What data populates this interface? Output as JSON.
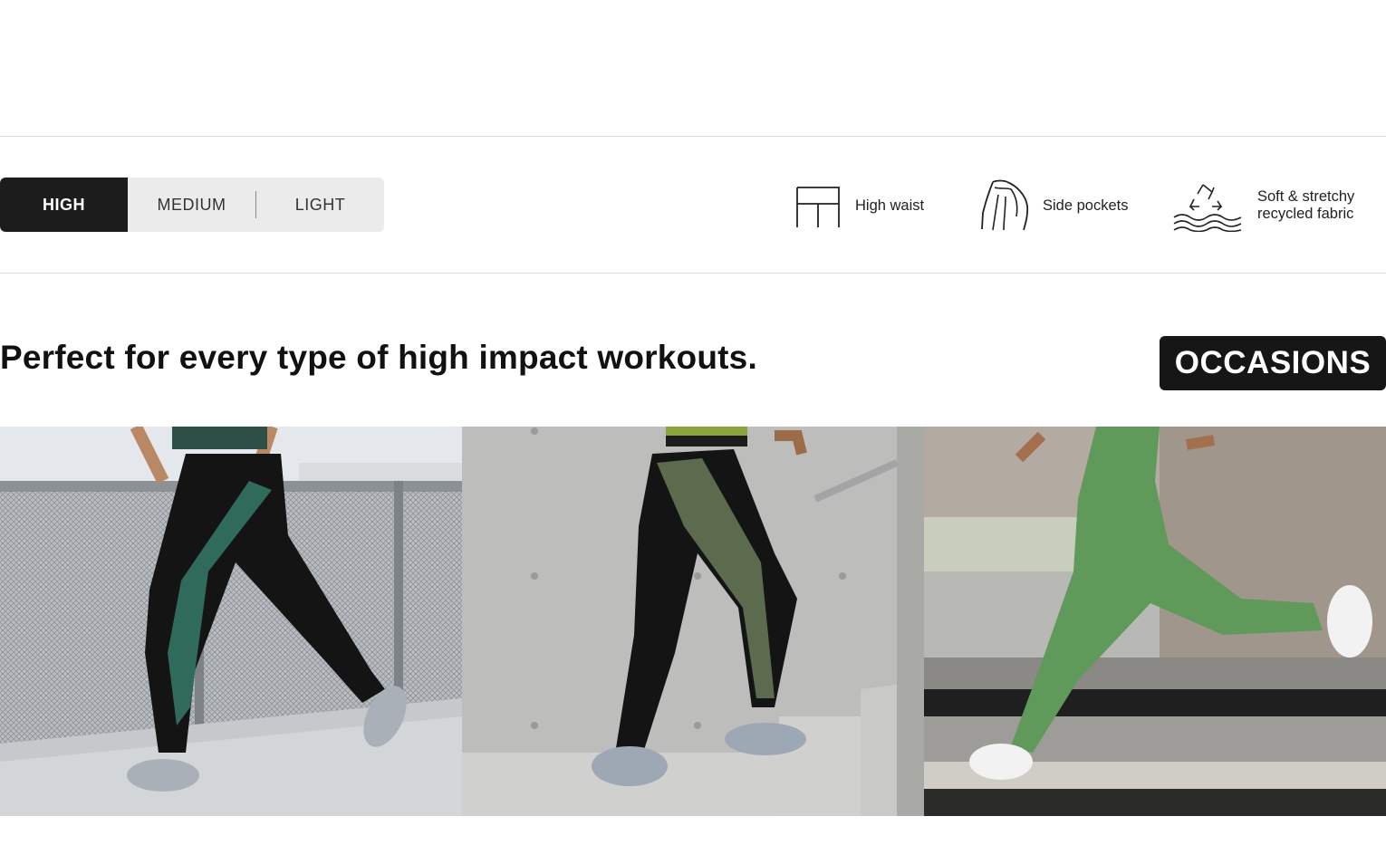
{
  "impact_selector": {
    "options": [
      "HIGH",
      "MEDIUM",
      "LIGHT"
    ],
    "selected": "HIGH"
  },
  "features": [
    {
      "icon": "high-waist-icon",
      "label": "High waist"
    },
    {
      "icon": "side-pockets-icon",
      "label": "Side pockets"
    },
    {
      "icon": "recycle-fabric-icon",
      "label_line1": "Soft & stretchy",
      "label_line2": "recycled fabric"
    }
  ],
  "section": {
    "headline": "Perfect for every type of high impact workouts.",
    "tag": "OCCASIONS"
  },
  "colors": {
    "accent_dark": "#1c1c1c",
    "selector_bg": "#ebebeb",
    "divider": "#dcdcdc"
  },
  "photos": [
    {
      "subject": "runner-black-camo-leggings-rooftop"
    },
    {
      "subject": "runner-black-camo-leggings-stairs"
    },
    {
      "subject": "runner-green-leggings-poolside"
    }
  ]
}
